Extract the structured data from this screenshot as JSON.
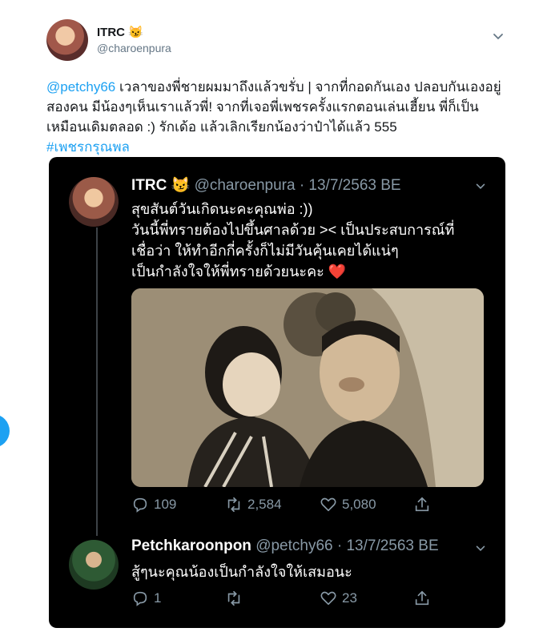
{
  "tweet": {
    "author_name": "ITRC",
    "author_emoji": "😼",
    "author_handle": "@charoenpura",
    "mention": "@petchy66",
    "body": " เวลาของพี่ชายผมมาถึงแล้วขรั่บ | จากที่กอดกันเอง ปลอบกันเองอยู่สองคน มีน้องๆเห็นเราแล้วพี่! จากที่เจอพี่เพชรครั้งแรกตอนเล่นเฮี้ยน พี่ก็เป็นเหมือนเดิมตลอด :) รักเด้อ แล้วเลิกเรียกน้องว่าป๋าได้แล้ว 555",
    "hashtag": "#เพชรกรุณพล"
  },
  "embed": {
    "tweet1": {
      "name": "ITRC",
      "emoji": "😼",
      "meta": "@charoenpura · 13/7/2563 BE",
      "lines": [
        "สุขสันต์วันเกิดนะคะคุณพ่อ :))",
        "วันนี้พี่ทรายต้องไปขึ้นศาลด้วย >< เป็นประสบการณ์ที่",
        "เชื่อว่า ให้ทำอีกกี่ครั้งก็ไม่มีวันคุ้นเคยได้แน่ๆ",
        "เป็นกำลังใจให้พี่ทรายด้วยนะคะ ❤️"
      ],
      "replies": "109",
      "retweets": "2,584",
      "likes": "5,080"
    },
    "tweet2": {
      "name": "Petchkaroonpon",
      "meta": "@petchy66 · 13/7/2563 BE",
      "text": "สู้ๆนะคุณน้องเป็นกำลังใจให้เสมอนะ",
      "replies": "1",
      "retweets": "",
      "likes": "23"
    }
  },
  "colors": {
    "accent": "#1da1f2",
    "muted": "#8899a6",
    "like_heart": "#e0245e"
  },
  "icons": [
    "chevron-down-icon",
    "reply-icon",
    "retweet-icon",
    "like-icon",
    "share-icon"
  ]
}
